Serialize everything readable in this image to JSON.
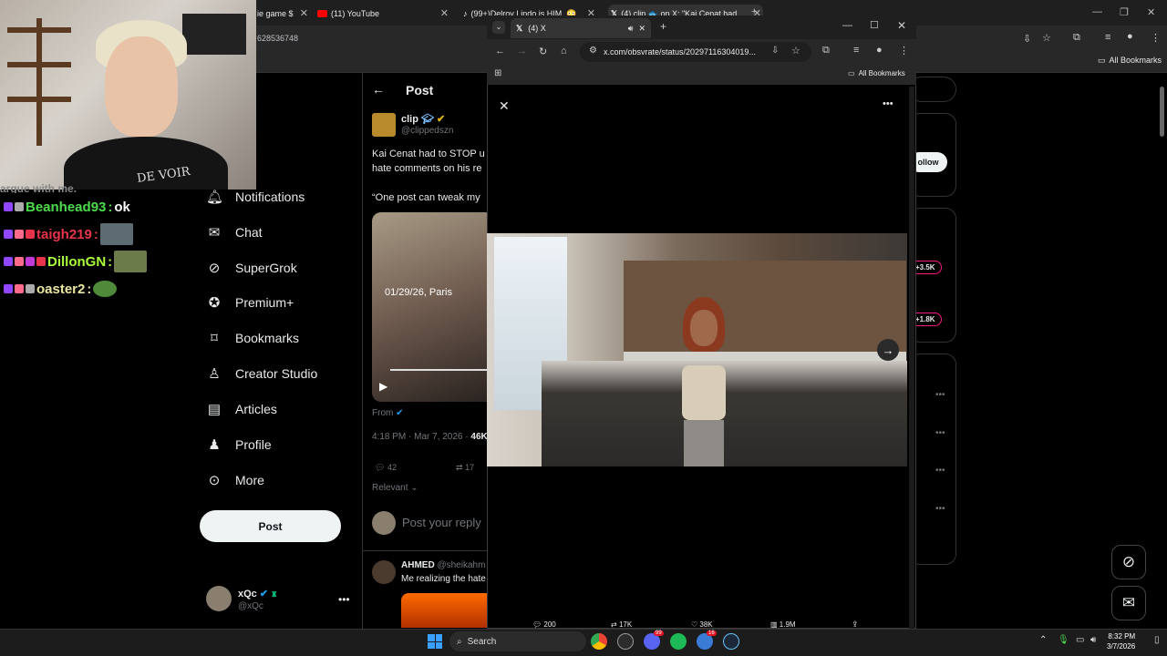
{
  "browser": {
    "tabs": [
      {
        "label": "ie game $"
      },
      {
        "label": "(11) YouTube"
      },
      {
        "label": "(99+)Delroy Lindo is HIM. 😳 🥔"
      },
      {
        "label": "(4) clip 🐟 on X: \"Kai Cenat had"
      }
    ],
    "address_partial": "628536748",
    "bookmarks_label": "All Bookmarks"
  },
  "chat": {
    "top_partial": "argue with me. ",
    "messages": [
      {
        "user": "Beanhead93",
        "text": " ok",
        "color": "#4ddb4d"
      },
      {
        "user": "taigh219",
        "text": "",
        "color": "#e8344b"
      },
      {
        "user": "DillonGN",
        "text": "",
        "color": "#aaff3a"
      },
      {
        "user": "oaster2",
        "text": "",
        "color": "#e8e6a0"
      }
    ]
  },
  "webcam": {
    "shirt_text": "DE VOIR"
  },
  "nav": {
    "home": "me",
    "explore": "lore",
    "notifications": "Notifications",
    "chat": "Chat",
    "supergrok": "SuperGrok",
    "premium": "Premium+",
    "bookmarks": "Bookmarks",
    "creator_studio": "Creator Studio",
    "articles": "Articles",
    "profile": "Profile",
    "more": "More",
    "post": "Post"
  },
  "account": {
    "name": "xQc",
    "handle": "@xQc"
  },
  "post": {
    "header": "Post",
    "author_name": "clip",
    "author_handle": "@clippedszn",
    "text_line1": "Kai Cenat had to STOP u",
    "text_line2": "hate comments on his re",
    "quote": "“One post can tweak my",
    "video_overlay": "01/29/26, Paris",
    "from_label": "From",
    "meta_time": "4:18 PM · Mar 7, 2026 · ",
    "meta_views": "46K",
    "replies": "42",
    "reposts": "17",
    "sort": "Relevant",
    "reply_placeholder": "Post your reply",
    "reply_author": "AHMED",
    "reply_handle": "@sheikahm",
    "reply_text": "Me realizing the hate"
  },
  "right_col": {
    "follow": "ollow",
    "pill1": "+3.5K",
    "pill2": "+1.8K"
  },
  "popup": {
    "tab_label": "(4) X",
    "url": "x.com/obsvrate/status/20297116304019...",
    "bookmarks_label": "All Bookmarks",
    "stats": [
      "200",
      "17K",
      "38K",
      "1.9M"
    ]
  },
  "taskbar": {
    "search": "Search",
    "time": "8:32 PM",
    "date": "3/7/2026",
    "discord_badge": "99",
    "steam_badge": "16"
  }
}
